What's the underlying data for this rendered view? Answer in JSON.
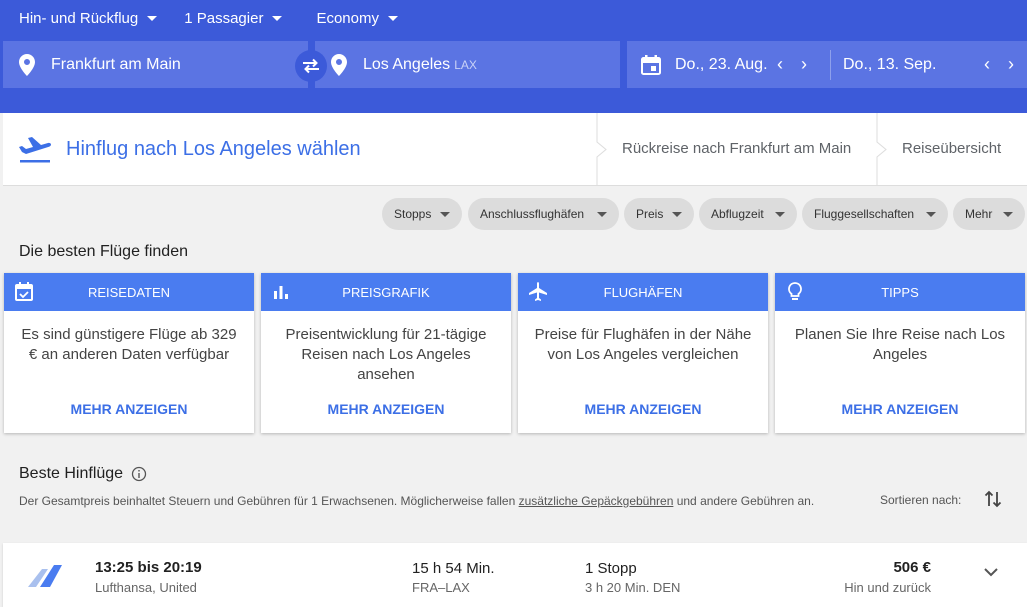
{
  "header": {
    "trip_type": "Hin- und Rückflug",
    "passengers": "1 Passagier",
    "cabin": "Economy",
    "origin": "Frankfurt am Main",
    "destination": "Los Angeles",
    "destination_code": "LAX",
    "depart_date": "Do., 23. Aug.",
    "return_date": "Do., 13. Sep."
  },
  "steps": {
    "current": "Hinflug nach Los Angeles wählen",
    "return": "Rückreise nach Frankfurt am Main",
    "summary": "Reiseübersicht"
  },
  "filters": [
    "Stopps",
    "Anschlussflughäfen",
    "Preis",
    "Abflugzeit",
    "Fluggesellschaften",
    "Mehr"
  ],
  "insights": {
    "title": "Die besten Flüge finden",
    "cards": [
      {
        "icon": "calendar-icon",
        "title": "REISEDATEN",
        "body": "Es sind günstigere Flüge ab 329 € an anderen Daten verfügbar",
        "link": "MEHR ANZEIGEN"
      },
      {
        "icon": "bar-chart-icon",
        "title": "PREISGRAFIK",
        "body": "Preisentwicklung für 21-tägige Reisen nach Los Angeles ansehen",
        "link": "MEHR ANZEIGEN"
      },
      {
        "icon": "airplane-icon",
        "title": "FLUGHÄFEN",
        "body": "Preise für Flughäfen in der Nähe von Los Angeles vergleichen",
        "link": "MEHR ANZEIGEN"
      },
      {
        "icon": "lightbulb-icon",
        "title": "TIPPS",
        "body": "Planen Sie Ihre Reise nach Los Angeles",
        "link": "MEHR ANZEIGEN"
      }
    ]
  },
  "results": {
    "title": "Beste Hinflüge",
    "note_before": "Der Gesamtpreis beinhaltet Steuern und Gebühren für 1 Erwachsenen. Möglicherweise fallen ",
    "note_link": "zusätzliche Gepäckgebühren",
    "note_after": " und andere Gebühren an.",
    "sort_label": "Sortieren nach:",
    "flights": [
      {
        "times": "13:25 bis 20:19",
        "airline": "Lufthansa, United",
        "duration": "15 h 54 Min.",
        "route": "FRA–LAX",
        "stops": "1 Stopp",
        "layover": "3 h 20 Min. DEN",
        "price": "506 €",
        "price_type": "Hin und zurück"
      }
    ]
  },
  "colors": {
    "header_bg": "#3c5ad9",
    "field_bg": "#5b74e3",
    "accent": "#3c6fe6",
    "card_head": "#4a7cf0"
  }
}
